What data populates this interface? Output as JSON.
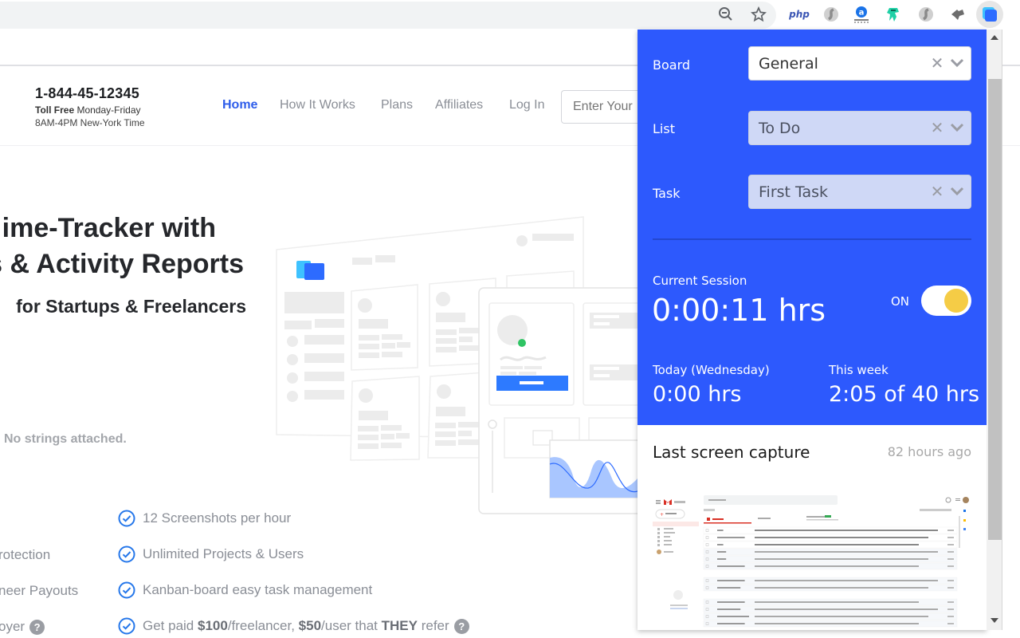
{
  "browser": {
    "toolbar_icons": [
      {
        "name": "zoom-out-icon",
        "label": ""
      },
      {
        "name": "bookmark-star-icon",
        "label": ""
      }
    ],
    "extensions": [
      {
        "name": "php-extension-icon",
        "label": "php"
      },
      {
        "name": "grey-s-extension-icon",
        "label": ""
      },
      {
        "name": "a-extension-icon",
        "label": "a"
      },
      {
        "name": "ninja-extension-icon",
        "label": ""
      },
      {
        "name": "grey-s2-extension-icon",
        "label": ""
      },
      {
        "name": "puzzle-extension-icon",
        "label": ""
      },
      {
        "name": "time-tracker-extension-icon",
        "label": ""
      }
    ]
  },
  "site": {
    "phone": "1-844-45-12345",
    "hours_bold": "Toll Free",
    "hours_line1": " Monday-Friday",
    "hours_line2": "8AM-4PM New-York Time",
    "nav": [
      "Home",
      "How It Works",
      "Plans",
      "Affiliates",
      "Log In"
    ],
    "email_placeholder": "Enter Your",
    "hero_line1": "ime-Tracker with",
    "hero_line2": "s & Activity Reports",
    "hero_line3": "for Startups & Freelancers",
    "no_strings": "No strings attached.",
    "features_left": [
      "rotection",
      "neer Payouts",
      "oyer"
    ],
    "features_right": [
      {
        "text": "12 Screenshots per hour"
      },
      {
        "text": "Unlimited Projects & Users"
      },
      {
        "text": "Kanban-board easy task management"
      },
      {
        "parts": [
          "Get paid ",
          "$100",
          "/freelancer, ",
          "$50",
          "/user that ",
          "THEY",
          " refer"
        ]
      }
    ],
    "help_glyph": "?"
  },
  "popup": {
    "brand_color": "#2d59fd",
    "board_label": "Board",
    "board_value": "General",
    "list_label": "List",
    "list_value": "To Do",
    "task_label": "Task",
    "task_value": "First Task",
    "clear_glyph": "✕",
    "current_session_label": "Current Session",
    "current_session_value": "0:00:11 hrs",
    "toggle_label": "ON",
    "toggle_on": true,
    "today_label": "Today (Wednesday)",
    "today_value": "0:00 hrs",
    "week_label": "This week",
    "week_value": "2:05 of 40 hrs",
    "last_capture_title": "Last screen capture",
    "last_capture_ago": "82 hours ago",
    "thumbnail": {
      "app": "Gmail",
      "search_placeholder": "Search mail",
      "compose": "Compose",
      "tabs": [
        "Primary",
        "Social",
        "Promotions"
      ],
      "senders": [
        "Me",
        "Techstars via F6S",
        "Me",
        "info",
        "info",
        "Geraldine Holiday",
        "Techstars via F6S",
        "Jill Lanko, me",
        "Techstars via F6S",
        "Catherine Guse",
        "Sam El Fateh via F6S",
        "Geraldine Holiday"
      ]
    }
  }
}
